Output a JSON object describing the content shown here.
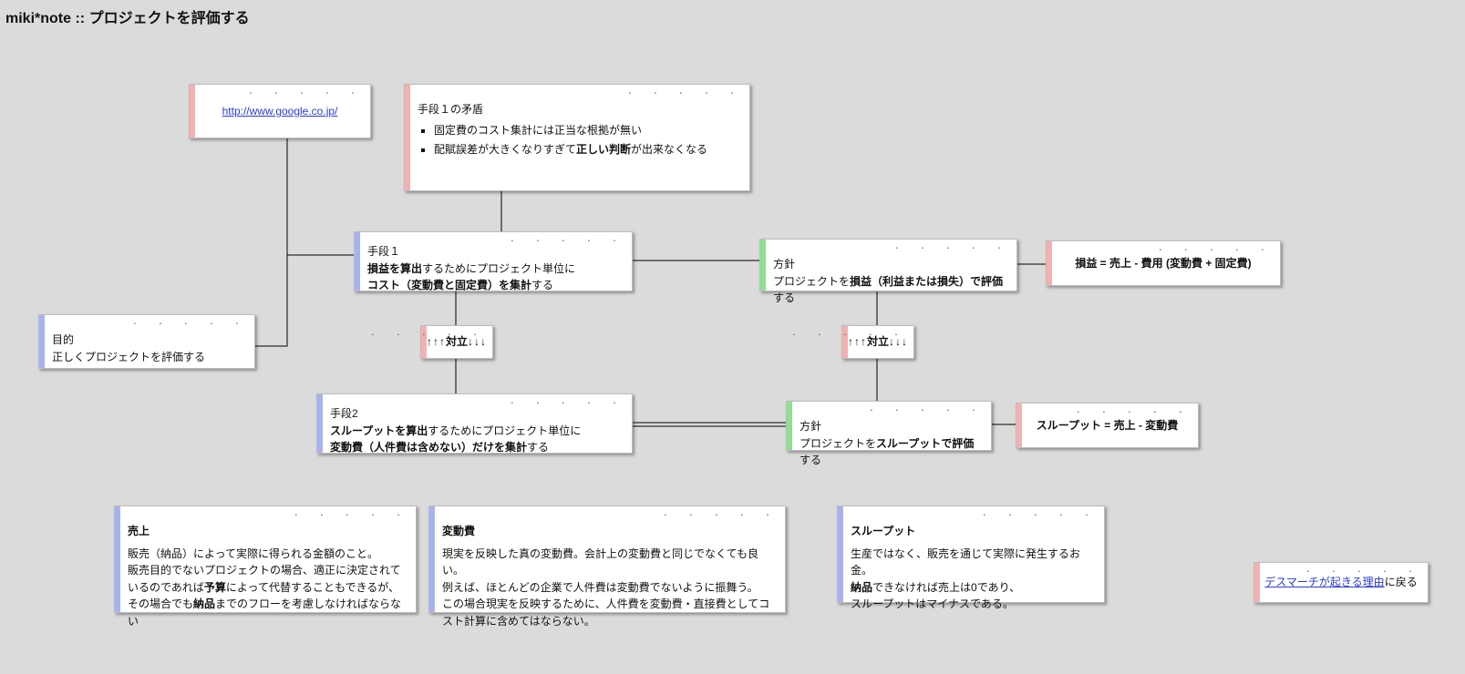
{
  "page": {
    "title": "miki*note :: プロジェクトを評価する",
    "dots": ". . . . ."
  },
  "nodes": {
    "link": {
      "url_text": "http://www.google.co.jp/"
    },
    "contradiction": {
      "label": "手段１の矛盾",
      "bullet1_plain": "固定費のコスト集計には正当な根拠が無い",
      "bullet2_pre": "配賦誤差が大きくなりすぎて",
      "bullet2_bold": "正しい判断",
      "bullet2_post": "が出来なくなる"
    },
    "means1": {
      "label": "手段１",
      "line1_pre": "",
      "line1_bold": "損益を算出",
      "line1_post": "するためにプロジェクト単位に",
      "line2_pre": "",
      "line2_bold": "コスト（変動費と固定費）を集計",
      "line2_post": "する"
    },
    "means2": {
      "label": "手段2",
      "line1_pre": "",
      "line1_bold": "スループットを算出",
      "line1_post": "するためにプロジェクト単位に",
      "line2_pre": "",
      "line2_bold": "変動費（人件費は含めない）だけを集計",
      "line2_post": "する"
    },
    "policy1": {
      "label": "方針",
      "text_pre": "プロジェクトを",
      "text_bold": "損益（利益または損失）で評価",
      "text_post": "する"
    },
    "policy2": {
      "label": "方針",
      "text_pre": "プロジェクトを",
      "text_bold": "スループットで評価",
      "text_post": "する"
    },
    "formula1": {
      "text": "損益 = 売上 - 費用 (変動費 + 固定費)"
    },
    "formula2": {
      "text": "スループット = 売上 - 変動費"
    },
    "goal": {
      "label": "目的",
      "text": "正しくプロジェクトを評価する"
    },
    "sales": {
      "title": "売上",
      "l1": "販売（納品）によって実際に得られる金額のこと。",
      "l2_pre": "販売目的でないプロジェクトの場合、適正に決定されているのであれば",
      "l2_bold": "予算",
      "l2_mid": "によって代替することもできるが、その場合でも",
      "l2_bold2": "納品",
      "l2_post": "までのフローを考慮しなければならない"
    },
    "varcost": {
      "title": "変動費",
      "l1": "現実を反映した真の変動費。会計上の変動費と同じでなくても良い。",
      "l2": "例えば、ほとんどの企業で人件費は変動費でないように振舞う。",
      "l3": "この場合現実を反映するために、人件費を変動費・直接費としてコスト計算に含めてはならない。"
    },
    "throughput": {
      "title": "スループット",
      "l1": "生産ではなく、販売を通じて実際に発生するお金。",
      "l2_bold": "納品",
      "l2_post": "できなければ売上は0であり、",
      "l3": "スループットはマイナスである。"
    },
    "backlink": {
      "link_text": "デスマーチが起きる理由",
      "suffix": "に戻る"
    }
  },
  "conflict": {
    "left": "↑↑↑",
    "word": "対立",
    "right": "↓↓↓"
  }
}
